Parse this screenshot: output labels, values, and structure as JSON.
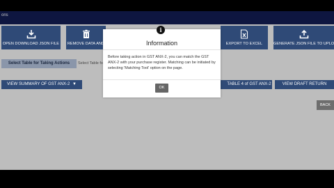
{
  "header": {
    "title": "ons"
  },
  "actions": [
    {
      "label": "OPEN DOWNLOAD JSON FILE",
      "icon": "download-icon"
    },
    {
      "label": "REMOVE DATA AND",
      "icon": "trash-icon"
    },
    {
      "label": "EXPORT TO EXCEL",
      "icon": "excel-icon"
    },
    {
      "label": "GENERATE JSON FILE TO UPLOAD",
      "icon": "upload-icon"
    }
  ],
  "table_select": {
    "label": "Select Table for Taking Actions",
    "placeholder": "Select Table fo"
  },
  "nav": {
    "view_summary": "VIEW SUMMARY OF GST ANX-2",
    "table4": "TABLE 4 of GST ANX-2",
    "view_draft": "VIEW DRAFT RETURN",
    "back": "BACK"
  },
  "modal": {
    "icon": "info-icon",
    "title": "Information",
    "message": "Before taking action in GST ANX-2, you can match the GST ANX-2 with your purchase register. Matching can be initiated by selecting 'Matching Tool' option on the page.",
    "ok_label": "OK"
  },
  "colors": {
    "primary_button": "#2f4a77",
    "topbar": "#0e1640",
    "overlay_background": "#bdbdbd",
    "ok_button": "#666666"
  }
}
